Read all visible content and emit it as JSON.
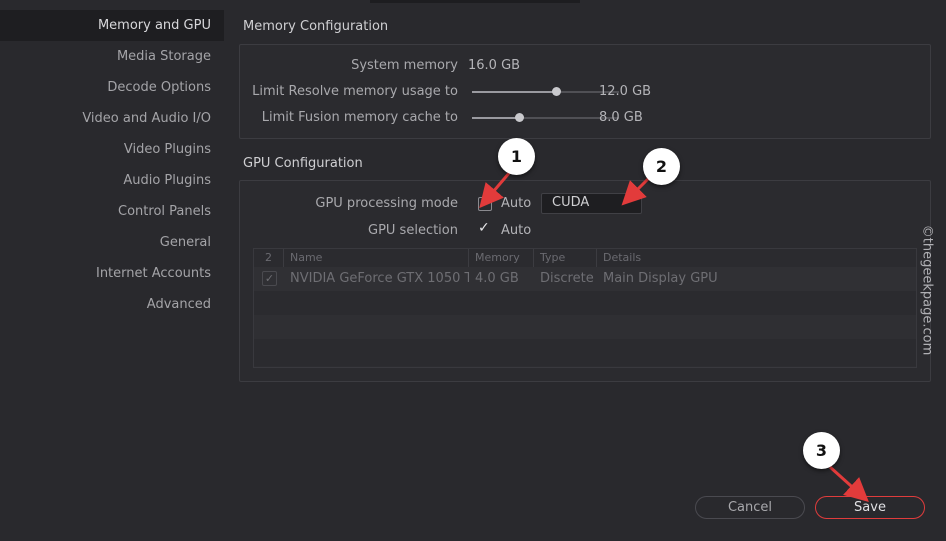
{
  "sidebar": {
    "items": [
      {
        "label": "Memory and GPU",
        "active": true
      },
      {
        "label": "Media Storage"
      },
      {
        "label": "Decode Options"
      },
      {
        "label": "Video and Audio I/O"
      },
      {
        "label": "Video Plugins"
      },
      {
        "label": "Audio Plugins"
      },
      {
        "label": "Control Panels"
      },
      {
        "label": "General"
      },
      {
        "label": "Internet Accounts"
      },
      {
        "label": "Advanced"
      }
    ]
  },
  "memory": {
    "title": "Memory Configuration",
    "system_label": "System memory",
    "system_value": "16.0 GB",
    "resolve_label": "Limit Resolve memory usage to",
    "resolve_value": "12.0 GB",
    "resolve_level": 0.75,
    "fusion_label": "Limit Fusion memory cache to",
    "fusion_value": "8.0 GB",
    "fusion_level": 0.5
  },
  "gpu": {
    "title": "GPU Configuration",
    "mode_label": "GPU processing mode",
    "mode_auto_label": "Auto",
    "mode_auto_checked": false,
    "mode_value": "CUDA",
    "selection_label": "GPU selection",
    "selection_auto_label": "Auto",
    "selection_auto_checked": true,
    "table": {
      "columns": [
        "2",
        "Name",
        "Memory",
        "Type",
        "Details"
      ],
      "rows": [
        {
          "checked": true,
          "name": "NVIDIA GeForce GTX 1050 Ti",
          "memory": "4.0 GB",
          "type": "Discrete",
          "details": "Main Display GPU"
        }
      ]
    }
  },
  "buttons": {
    "cancel": "Cancel",
    "save": "Save"
  },
  "callouts": [
    "1",
    "2",
    "3"
  ],
  "watermark": "©thegeekpage.com",
  "colors": {
    "background": "#29292d",
    "sidebar_active": "#1e1e21",
    "save_accent": "#e03c3c",
    "callout_arrow": "#e23b3b"
  }
}
